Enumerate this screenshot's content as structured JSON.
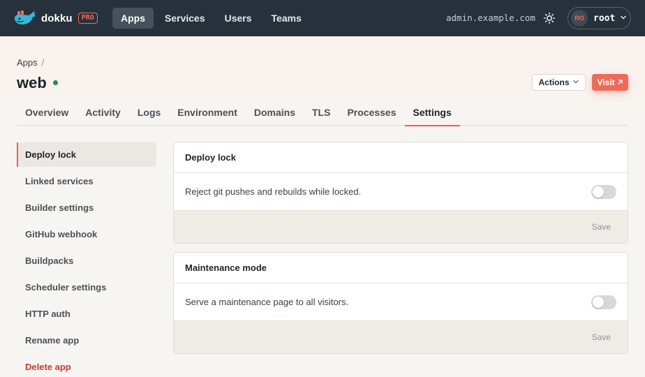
{
  "brand": {
    "name": "dokku",
    "badge": "PRO"
  },
  "nav": {
    "items": [
      {
        "label": "Apps",
        "active": true
      },
      {
        "label": "Services",
        "active": false
      },
      {
        "label": "Users",
        "active": false
      },
      {
        "label": "Teams",
        "active": false
      }
    ]
  },
  "host": "admin.example.com",
  "user": {
    "initials": "RO",
    "name": "root"
  },
  "breadcrumb": {
    "root": "Apps",
    "separator": "/"
  },
  "app": {
    "name": "web",
    "status_color": "#1f8a5b"
  },
  "header_actions": {
    "actions_label": "Actions",
    "visit_label": "Visit"
  },
  "tabs": [
    {
      "label": "Overview"
    },
    {
      "label": "Activity"
    },
    {
      "label": "Logs"
    },
    {
      "label": "Environment"
    },
    {
      "label": "Domains"
    },
    {
      "label": "TLS"
    },
    {
      "label": "Processes"
    },
    {
      "label": "Settings",
      "active": true
    }
  ],
  "sidebar": {
    "items": [
      {
        "label": "Deploy lock",
        "active": true
      },
      {
        "label": "Linked services"
      },
      {
        "label": "Builder settings"
      },
      {
        "label": "GitHub webhook"
      },
      {
        "label": "Buildpacks"
      },
      {
        "label": "Scheduler settings"
      },
      {
        "label": "HTTP auth"
      },
      {
        "label": "Rename app"
      },
      {
        "label": "Delete app",
        "danger": true
      }
    ]
  },
  "cards": {
    "deploy_lock": {
      "title": "Deploy lock",
      "description": "Reject git pushes and rebuilds while locked.",
      "enabled": false,
      "save_label": "Save"
    },
    "maintenance": {
      "title": "Maintenance mode",
      "description": "Serve a maintenance page to all visitors.",
      "enabled": false,
      "save_label": "Save"
    }
  },
  "colors": {
    "accent": "#ee6b59",
    "nav_bg": "#26313b",
    "danger": "#cc3b2f"
  }
}
